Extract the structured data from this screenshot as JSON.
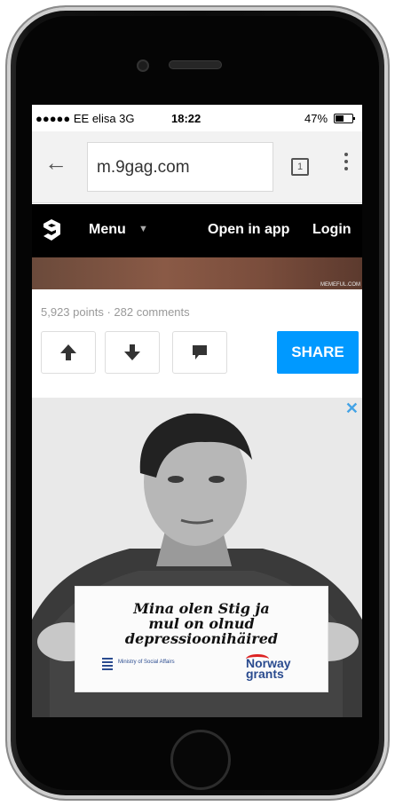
{
  "status_bar": {
    "carrier": "●●●●● EE elisa 3G",
    "time": "18:22",
    "battery": "47%"
  },
  "browser": {
    "url": "m.9gag.com",
    "tab_count": "1"
  },
  "nav": {
    "menu_label": "Menu",
    "open_in_app": "Open in app",
    "login": "Login"
  },
  "post": {
    "watermark": "MEMEFUL.COM",
    "meta": "5,923 points · 282 comments",
    "share_label": "SHARE"
  },
  "ad": {
    "close": "✕",
    "line1": "Mina olen Stig ja",
    "line2": "mul on olnud",
    "line3": "depressioonihäired",
    "ministry": "Ministry of Social Affairs",
    "sponsor_line1": "Norway",
    "sponsor_line2": "grants"
  },
  "colors": {
    "share": "#0099ff",
    "nav_bg": "#000000",
    "close": "#44a3e6"
  }
}
